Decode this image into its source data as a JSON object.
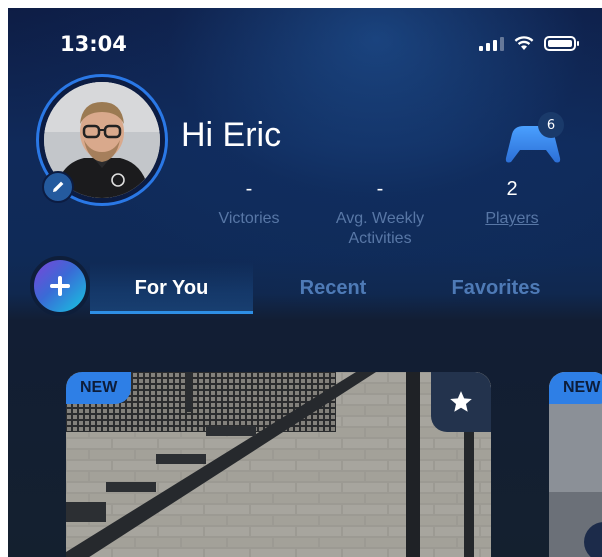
{
  "status_bar": {
    "time": "13:04"
  },
  "profile": {
    "greeting": "Hi Eric",
    "avatar_icon": "user-photo",
    "edit_icon": "pencil-icon"
  },
  "controller": {
    "badge_count": "6",
    "icon": "gamepad-icon"
  },
  "stats": [
    {
      "value": "-",
      "label": "Victories",
      "link": false
    },
    {
      "value": "-",
      "label_line1": "Avg. Weekly",
      "label_line2": "Activities",
      "link": false
    },
    {
      "value": "2",
      "label": "Players",
      "link": true
    }
  ],
  "tabs": [
    {
      "label": "For You",
      "active": true
    },
    {
      "label": "Recent",
      "active": false
    },
    {
      "label": "Favorites",
      "active": false
    }
  ],
  "cards": [
    {
      "badge": "NEW",
      "favorite_icon": "star-icon"
    },
    {
      "badge": "NEW"
    }
  ],
  "colors": {
    "accent": "#2e7fe6",
    "tab_inactive": "#4e7ab6",
    "label": "#5877a6"
  }
}
